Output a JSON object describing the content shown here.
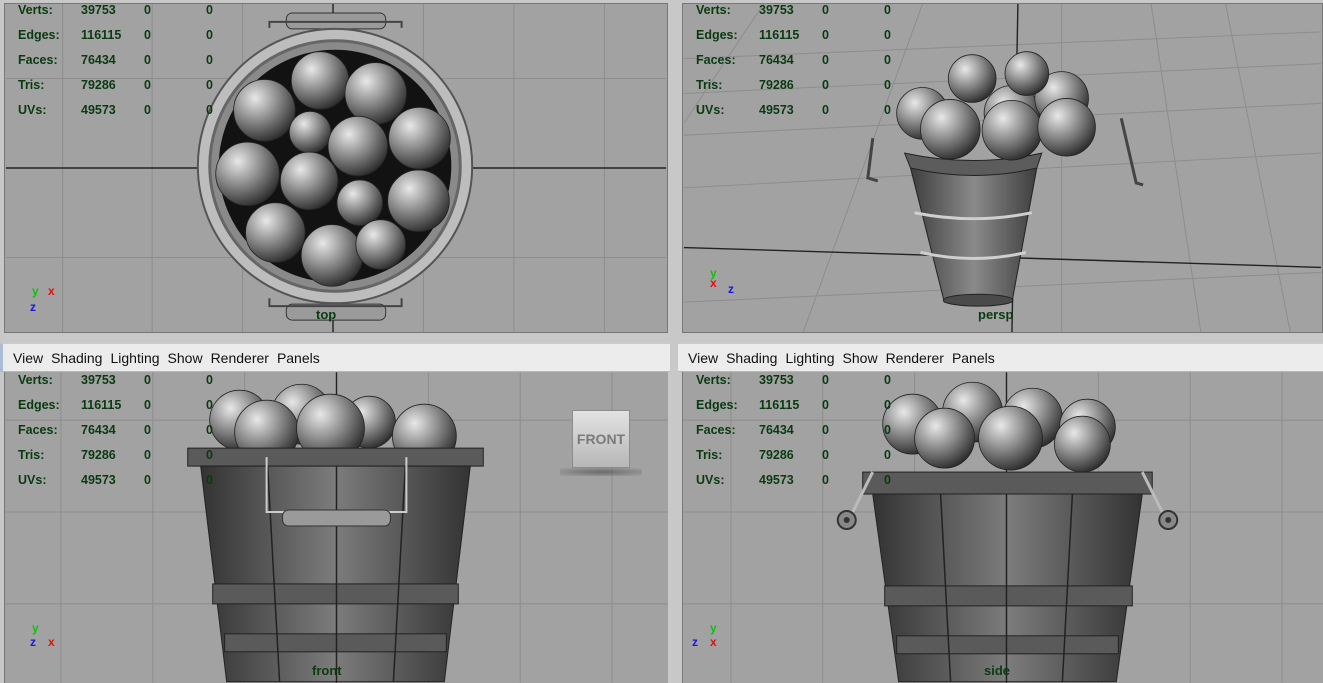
{
  "menus": [
    "View",
    "Shading",
    "Lighting",
    "Show",
    "Renderer",
    "Panels"
  ],
  "hud": [
    {
      "label": "Verts:",
      "value": "39753",
      "a": "0",
      "b": "0"
    },
    {
      "label": "Edges:",
      "value": "116115",
      "a": "0",
      "b": "0"
    },
    {
      "label": "Faces:",
      "value": "76434",
      "a": "0",
      "b": "0"
    },
    {
      "label": "Tris:",
      "value": "79286",
      "a": "0",
      "b": "0"
    },
    {
      "label": "UVs:",
      "value": "49573",
      "a": "0",
      "b": "0"
    }
  ],
  "cameras": {
    "top": "top",
    "persp": "persp",
    "front": "front",
    "side": "side"
  },
  "axes": {
    "x": "x",
    "y": "y",
    "z": "z"
  },
  "viewcube": "FRONT",
  "colors": {
    "axis_x": "#e01010",
    "axis_y": "#10c010",
    "axis_z": "#1818e0",
    "hud_text": "#0a3a12",
    "viewport_bg": "#a2a2a2"
  },
  "icons": [
    "basket-apples-model"
  ]
}
